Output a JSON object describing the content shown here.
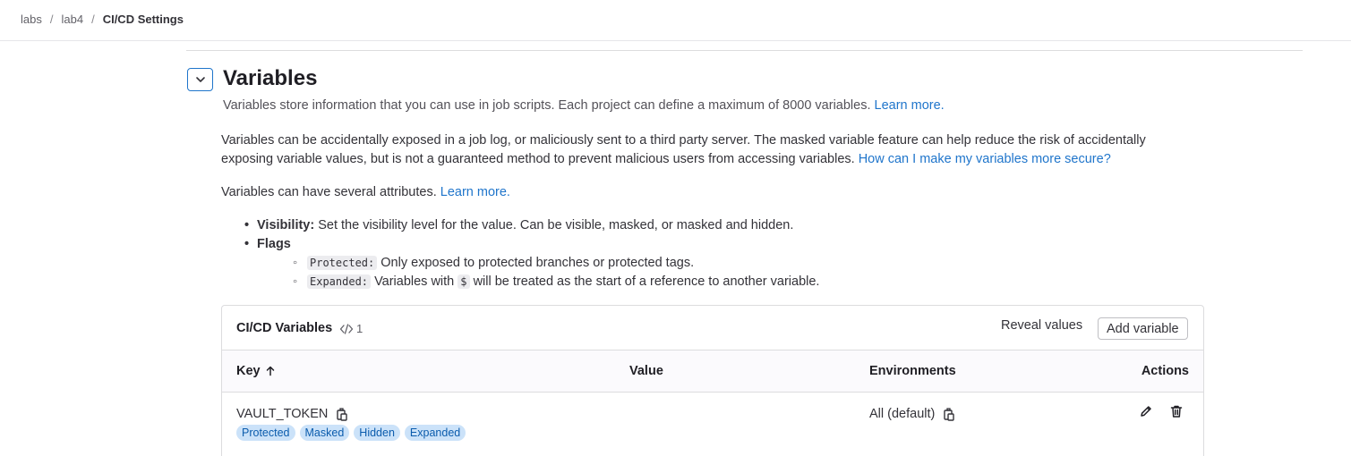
{
  "breadcrumb": [
    "labs",
    "lab4",
    "CI/CD Settings"
  ],
  "section": {
    "title": "Variables",
    "description": "Variables store information that you can use in job scripts. Each project can define a maximum of 8000 variables.",
    "learn_more": "Learn more."
  },
  "warning": {
    "text": "Variables can be accidentally exposed in a job log, or maliciously sent to a third party server. The masked variable feature can help reduce the risk of accidentally exposing variable values, but is not a guaranteed method to prevent malicious users from accessing variables.",
    "link": "How can I make my variables more secure?"
  },
  "attributes": {
    "intro": "Variables can have several attributes.",
    "learn_more": "Learn more.",
    "visibility_label": "Visibility:",
    "visibility_text": "Set the visibility level for the value. Can be visible, masked, or masked and hidden.",
    "flags_label": "Flags",
    "protected_code": "Protected:",
    "protected_text": "Only exposed to protected branches or protected tags.",
    "expanded_code": "Expanded:",
    "expanded_text_1": "Variables with",
    "dollar_code": "$",
    "expanded_text_2": "will be treated as the start of a reference to another variable."
  },
  "card": {
    "title": "CI/CD Variables",
    "count": "1",
    "reveal_label": "Reveal values",
    "add_label": "Add variable"
  },
  "table": {
    "headers": {
      "key": "Key",
      "value": "Value",
      "environments": "Environments",
      "actions": "Actions"
    },
    "rows": [
      {
        "key": "VAULT_TOKEN",
        "environment": "All (default)",
        "badges": [
          "Protected",
          "Masked",
          "Hidden",
          "Expanded"
        ]
      }
    ]
  },
  "colors": {
    "link": "#1f75cb",
    "badge_bg": "#cbe2f9",
    "badge_text": "#0b5cad"
  }
}
